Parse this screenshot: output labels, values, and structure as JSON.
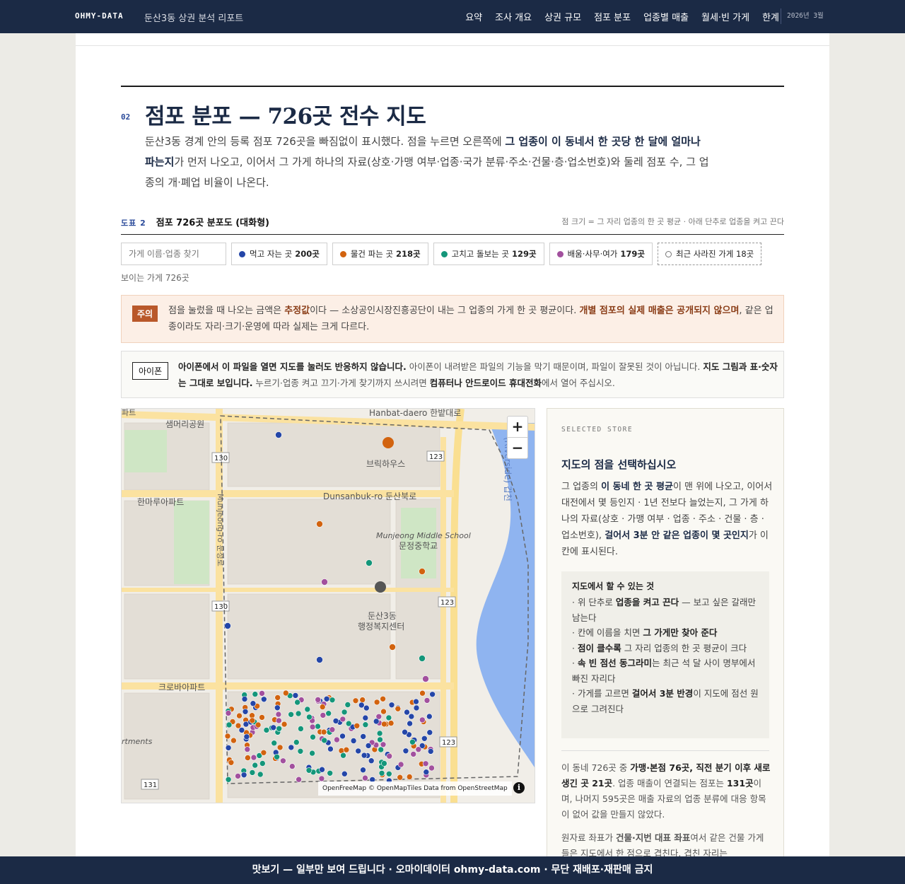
{
  "nav": {
    "brand": "OHMY-DATA",
    "subtitle": "둔산3동 상권 분석 리포트",
    "links": [
      "요약",
      "조사 개요",
      "상권 규모",
      "점포 분포",
      "업종별 매출",
      "월세·빈 가게",
      "한계"
    ],
    "date": "2026년 3월"
  },
  "section": {
    "number": "02",
    "title": "점포 분포 — 726곳 전수 지도",
    "lead_a": "둔산3동 경계 안의 등록 점포 726곳을 빠짐없이 표시했다. 점을 누르면 오른쪽에 ",
    "lead_b": "그 업종이 이 동네서 한 곳당 한 달에 얼마나 파는지",
    "lead_c": "가 먼저 나오고, 이어서 그 가게 하나의 자료(상호·가맹 여부·업종·국가 분류·주소·건물·층·업소번호)와 둘레 점포 수, 그 업종의 개·폐업 비율이 나온다."
  },
  "figure": {
    "label": "도표 2",
    "title": "점포 726곳 분포도 (대화형)",
    "note": "점 크기 = 그 자리 업종의 한 곳 평균 · 아래 단추로 업종을 켜고 끈다"
  },
  "filters": {
    "search_placeholder": "가게 이름·업종 찾기",
    "chips": [
      {
        "label": "먹고 자는 곳",
        "count": "200곳",
        "color": "#2446a8"
      },
      {
        "label": "물건 파는 곳",
        "count": "218곳",
        "color": "#d2630f"
      },
      {
        "label": "고치고 돌보는 곳",
        "count": "129곳",
        "color": "#14967a"
      },
      {
        "label": "배움·사무·여가",
        "count": "179곳",
        "color": "#a2509e"
      }
    ],
    "closed_label": "최근 사라진 가게",
    "closed_count": "18곳",
    "visible": "보이는 가게 726곳"
  },
  "warning": {
    "tag": "주의",
    "t1": "점을 눌렀을 때 나오는 금액은 ",
    "t1b": "추정값",
    "t2": "이다 — 소상공인시장진흥공단이 내는 그 업종의 가게 한 곳 평균이다. ",
    "t2b": "개별 점포의 실제 매출은 공개되지 않으며",
    "t3": ", 같은 업종이라도 자리·크기·운영에 따라 실제는 크게 다르다."
  },
  "iphone": {
    "tag": "아이폰",
    "b1": "아이폰에서 이 파일을 열면 지도를 눌러도 반응하지 않습니다.",
    "t1": " 아이폰이 내려받은 파일의 기능을 막기 때문이며, 파일이 잘못된 것이 아닙니다. ",
    "b2": "지도 그림과 표·숫자는 그대로 보입니다.",
    "t2": " 누르기·업종 켜고 끄기·가게 찾기까지 쓰시려면 ",
    "b3": "컴퓨터나 안드로이드 휴대전화",
    "t3": "에서 열어 주십시오."
  },
  "map": {
    "labels": {
      "hanbat": "Hanbat-daero 한밭대로",
      "dunsanbuk": "Dunsanbuk-ro 둔산북로",
      "park": "샘머리공원",
      "apt1": "한마루아파트",
      "apt2": "크로바아파트",
      "apt3": "rtments",
      "school_en": "Munjeong Middle School",
      "school_ko": "문정중학교",
      "center1": "둔산3동",
      "center2": "행정복지센터",
      "brick": "브릭하우스",
      "river": "(Riverside) 갑천",
      "road_v": "Munjeong-ro 문정로",
      "r130a": "130",
      "r130b": "130",
      "r123a": "123",
      "r123b": "123",
      "r123c": "123",
      "r131": "131",
      "edge": "파트"
    },
    "zoom_in": "+",
    "zoom_out": "−",
    "attribution": "OpenFreeMap © OpenMapTiles Data from OpenStreetMap",
    "info": "i"
  },
  "side": {
    "label": "SELECTED STORE",
    "title": "지도의 점을 선택하십시오",
    "p1a": "그 업종의 ",
    "p1b": "이 동네 한 곳 평균",
    "p1c": "이 맨 위에 나오고, 이어서 대전에서 몇 등인지 · 1년 전보다 늘었는지, 그 가게 하나의 자료(상호 · 가맹 여부 · 업종 · 주소 · 건물 · 층 · 업소번호), ",
    "p1d": "걸어서 3분 안 같은 업종이 몇 곳인지",
    "p1e": "가 이 칸에 표시된다.",
    "how_title": "지도에서 할 수 있는 것",
    "how": [
      {
        "pre": "· 위 단추로 ",
        "b": "업종을 켜고 끈다",
        "post": " — 보고 싶은 갈래만 남는다"
      },
      {
        "pre": "· 칸에 이름을 치면 ",
        "b": "그 가게만 찾아 준다",
        "post": ""
      },
      {
        "pre": "· ",
        "b": "점이 클수록",
        "post": " 그 자리 업종의 한 곳 평균이 크다"
      },
      {
        "pre": "· ",
        "b": "속 빈 점선 동그라미",
        "post": "는 최근 석 달 사이 명부에서 빠진 자리다"
      },
      {
        "pre": "· 가게를 고르면 ",
        "b": "걸어서 3분 반경",
        "post": "이 지도에 점선 원으로 그려진다"
      }
    ],
    "p2a": "이 동네 726곳 중 ",
    "p2b": "가맹·본점 76곳, 직전 분기 이후 새로 생긴 곳 21곳",
    "p2c": ". 업종 매출이 연결되는 점포는 ",
    "p2d": "131곳",
    "p2e": "이며, 나머지 595곳은 매출 자료의 업종 분류에 대응 항목이 없어 값을 만들지 않았다.",
    "p3a": "원자료 좌표가 ",
    "p3b": "건물·지번 대표 좌표",
    "p3c": "여서 같은 건물 가게들은 지도에서 한 점으로 겹친다. 겹친 자리는"
  },
  "footer": "맛보기 — 일부만 보여 드립니다 · 오마이데이터 ohmy-data.com · 무단 재배포·재판매 금지"
}
